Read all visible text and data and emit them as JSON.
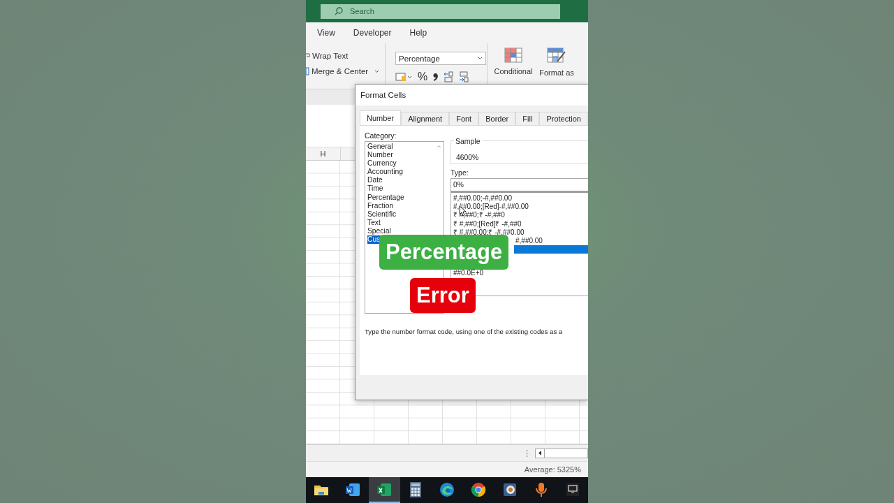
{
  "search": {
    "placeholder": "Search"
  },
  "menu": [
    {
      "label": "View"
    },
    {
      "label": "Developer"
    },
    {
      "label": "Help"
    }
  ],
  "ribbon": {
    "wrap_text": "Wrap Text",
    "merge_center": "Merge & Center",
    "number_format": "Percentage",
    "percent": "%",
    "conditional": "Conditional",
    "format_table": "Format as"
  },
  "sheet": {
    "column_header": "H"
  },
  "dialog": {
    "title": "Format Cells",
    "tabs": [
      {
        "label": "Number",
        "selected": true
      },
      {
        "label": "Alignment",
        "selected": false
      },
      {
        "label": "Font",
        "selected": false
      },
      {
        "label": "Border",
        "selected": false
      },
      {
        "label": "Fill",
        "selected": false
      },
      {
        "label": "Protection",
        "selected": false
      }
    ],
    "category_label": "Category:",
    "categories": [
      {
        "label": "General",
        "selected": false
      },
      {
        "label": "Number",
        "selected": false
      },
      {
        "label": "Currency",
        "selected": false
      },
      {
        "label": "Accounting",
        "selected": false
      },
      {
        "label": "Date",
        "selected": false
      },
      {
        "label": "Time",
        "selected": false
      },
      {
        "label": "Percentage",
        "selected": false
      },
      {
        "label": "Fraction",
        "selected": false
      },
      {
        "label": "Scientific",
        "selected": false
      },
      {
        "label": "Text",
        "selected": false
      },
      {
        "label": "Special",
        "selected": false
      },
      {
        "label": "Cus",
        "selected": true
      }
    ],
    "sample_label": "Sample",
    "sample_value": "4600%",
    "type_label": "Type:",
    "type_value": "0%",
    "codes": [
      {
        "kind": "row",
        "text": "#,##0.00;-#,##0.00",
        "selected": false
      },
      {
        "kind": "row",
        "text": "#,##0.00;[Red]-#,##0.00",
        "selected": false
      },
      {
        "kind": "row",
        "text": "₹ #,##0;₹ -#,##0",
        "selected": false
      },
      {
        "kind": "row",
        "text": "₹ #,##0;[Red]₹ -#,##0",
        "selected": false
      },
      {
        "kind": "row",
        "text": "₹ #,##0.00;₹ -#,##0.00",
        "selected": false
      },
      {
        "kind": "tail",
        "text": "#,##0.00",
        "selected": false
      },
      {
        "kind": "tail",
        "selected": true
      },
      {
        "kind": "gap"
      },
      {
        "kind": "row",
        "text": "##0.0E+0",
        "selected": false
      }
    ],
    "description": "Type the number format code, using one of the existing codes as a"
  },
  "status_bar": {
    "average": "Average: 5325%"
  },
  "taskbar": [
    {
      "kind": "folder",
      "selected": false
    },
    {
      "kind": "word",
      "selected": false
    },
    {
      "kind": "excel",
      "selected": true
    },
    {
      "kind": "calculator",
      "selected": false
    },
    {
      "kind": "edge",
      "selected": false
    },
    {
      "kind": "chrome",
      "selected": false
    },
    {
      "kind": "viewer",
      "selected": false
    },
    {
      "kind": "mic",
      "selected": false
    },
    {
      "kind": "remote",
      "selected": false
    }
  ],
  "captions": [
    {
      "text": "Percentage",
      "color": "#3cb043"
    },
    {
      "text": "Error",
      "color": "#e5000c"
    }
  ]
}
